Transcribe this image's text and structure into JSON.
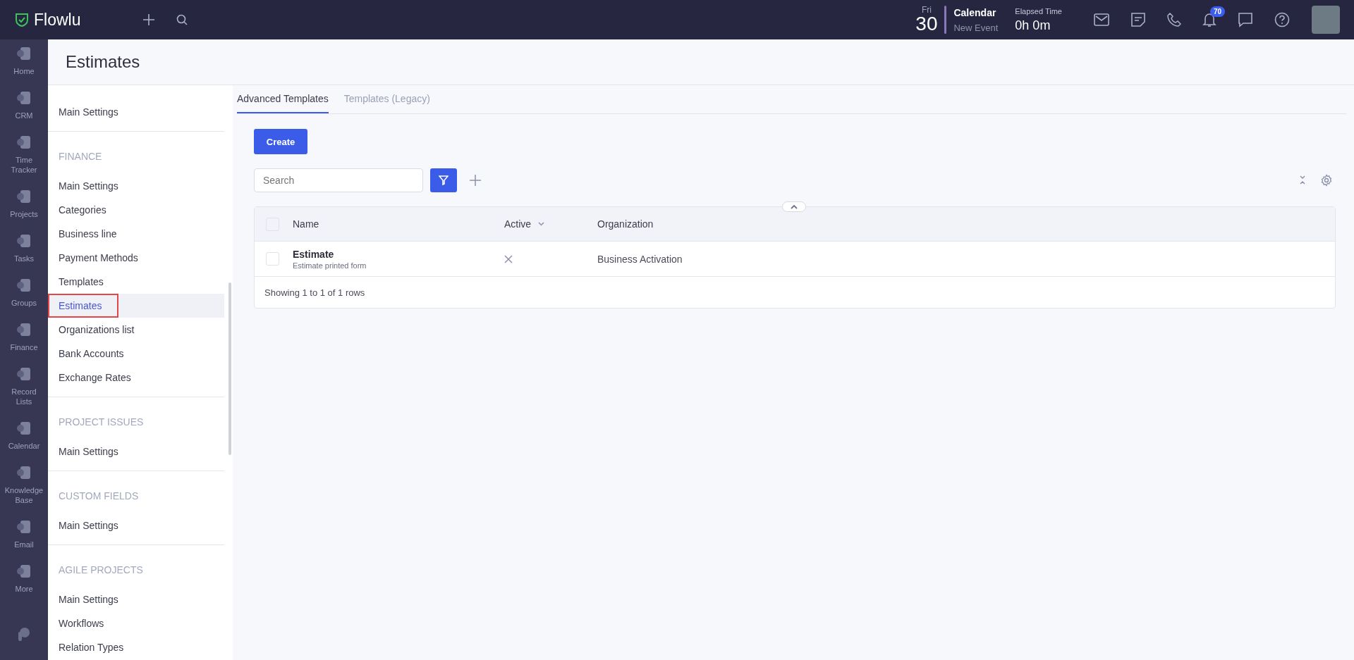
{
  "topbar": {
    "logo": "Flowlu",
    "date": {
      "weekday": "Fri",
      "day": "30"
    },
    "calendar": {
      "title": "Calendar",
      "subtitle": "New Event"
    },
    "elapsed": {
      "label": "Elapsed Time",
      "value": "0h 0m"
    },
    "notifications": "70"
  },
  "nav": [
    {
      "label": "Home"
    },
    {
      "label": "CRM"
    },
    {
      "label": "Time Tracker"
    },
    {
      "label": "Projects"
    },
    {
      "label": "Tasks"
    },
    {
      "label": "Groups"
    },
    {
      "label": "Finance"
    },
    {
      "label": "Record Lists"
    },
    {
      "label": "Calendar"
    },
    {
      "label": "Knowledge Base"
    },
    {
      "label": "Email"
    },
    {
      "label": "More"
    }
  ],
  "page_title": "Estimates",
  "sidebar": [
    {
      "items": [
        {
          "label": "Main Settings",
          "selected": false
        }
      ]
    },
    {
      "heading": "FINANCE",
      "items": [
        {
          "label": "Main Settings",
          "selected": false
        },
        {
          "label": "Categories",
          "selected": false
        },
        {
          "label": "Business line",
          "selected": false
        },
        {
          "label": "Payment Methods",
          "selected": false
        },
        {
          "label": "Templates",
          "selected": false
        },
        {
          "label": "Estimates",
          "selected": true
        },
        {
          "label": "Organizations list",
          "selected": false
        },
        {
          "label": "Bank Accounts",
          "selected": false
        },
        {
          "label": "Exchange Rates",
          "selected": false
        }
      ]
    },
    {
      "heading": "PROJECT ISSUES",
      "items": [
        {
          "label": "Main Settings",
          "selected": false
        }
      ]
    },
    {
      "heading": "CUSTOM FIELDS",
      "items": [
        {
          "label": "Main Settings",
          "selected": false
        }
      ]
    },
    {
      "heading": "AGILE PROJECTS",
      "items": [
        {
          "label": "Main Settings",
          "selected": false
        },
        {
          "label": "Workflows",
          "selected": false
        },
        {
          "label": "Relation Types",
          "selected": false
        }
      ]
    }
  ],
  "tabs": [
    {
      "label": "Advanced Templates",
      "selected": true
    },
    {
      "label": "Templates (Legacy)",
      "selected": false
    }
  ],
  "create_button": "Create",
  "search": {
    "placeholder": "Search"
  },
  "table": {
    "expanded": true,
    "all_checked": false,
    "columns": [
      {
        "label": "Name",
        "sortable": false
      },
      {
        "label": "Active",
        "sortable": true
      },
      {
        "label": "Organization",
        "sortable": false
      }
    ],
    "rows": [
      {
        "checked": false,
        "name": "Estimate",
        "description": "Estimate printed form",
        "active": false,
        "organization": "Business Activation"
      }
    ],
    "footer": "Showing 1 to 1 of 1 rows"
  }
}
